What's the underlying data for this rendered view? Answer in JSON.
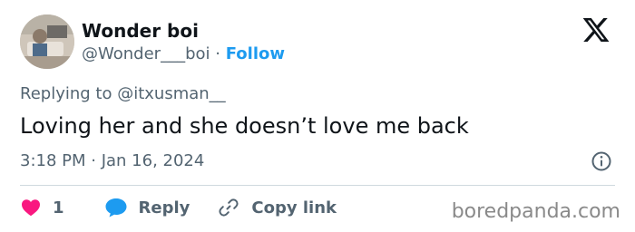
{
  "user": {
    "display_name": "Wonder boi",
    "handle": "@Wonder___boi",
    "separator": "·",
    "follow_label": "Follow"
  },
  "tweet": {
    "replying_to": "Replying to @itxusman__",
    "text": "Loving her and she doesn’t love me back",
    "timestamp": "3:18 PM · Jan 16, 2024"
  },
  "actions": {
    "like_count": "1",
    "reply_label": "Reply",
    "copy_label": "Copy link"
  },
  "watermark": "boredpanda.com",
  "colors": {
    "text": "#0f1419",
    "secondary": "#536471",
    "accent": "#1d9bf0",
    "like": "#f91880",
    "divider": "#cfd9de"
  },
  "icons": {
    "brand": "x-logo-icon",
    "info": "info-icon",
    "like": "heart-icon",
    "reply": "speech-bubble-icon",
    "copy": "link-icon"
  }
}
